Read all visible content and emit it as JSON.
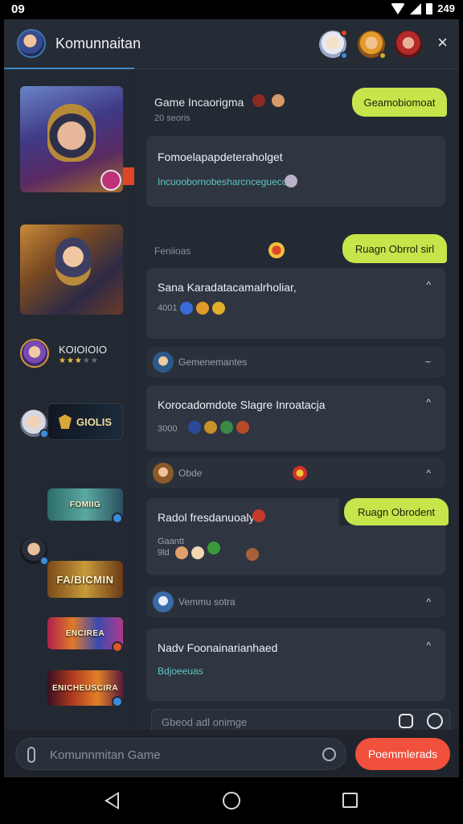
{
  "status": {
    "time": "09",
    "battery": "249"
  },
  "header": {
    "title": "Komunnaitan",
    "close": "×"
  },
  "sidebar": {
    "user_name": "KOIOIOIO",
    "user_stars": 3,
    "guild_label": "GIOLIS",
    "banners": [
      "FOMIIG",
      "FA/BICMIN",
      "ENCIREA",
      "ENICHEUSCIRA"
    ]
  },
  "feed": {
    "game_title": "Game Incaorigma",
    "game_sub": "20 seoris",
    "pill_1": "Geamobiomoat",
    "card_1": {
      "title": "Fomoelapapdeteraholget",
      "link": "Incuoobornobesharcnceguecom"
    },
    "section_label": "Feniioas",
    "pill_2": "Ruagn Obrrol sirl",
    "card_2": {
      "title": "Sana Karadatacamalrholiar,",
      "meta": "4001"
    },
    "strip_1": "Gemenemantes",
    "card_3": {
      "title": "Korocadomdote Slagre Inroatacja",
      "meta": "3000"
    },
    "strip_2": "Obde",
    "pill_3": "Ruagn Obrodent",
    "card_4": {
      "title": "Radol fresdanuoaly",
      "meta_1": "Gaantt",
      "meta_2": "9ld"
    },
    "strip_3": "Vemmu sotra",
    "card_5": {
      "title": "Nadv Foonainarianhaed",
      "link": "Bdjoeeuas"
    },
    "composer_placeholder": "Gbeod adl onimge"
  },
  "bottom": {
    "placeholder": "Komunnmitan Game",
    "send_label": "Poemmlerads"
  },
  "colors": {
    "accent_pill": "#c6e54a",
    "send": "#f0503c",
    "tab_underline": "#3e86c9"
  }
}
